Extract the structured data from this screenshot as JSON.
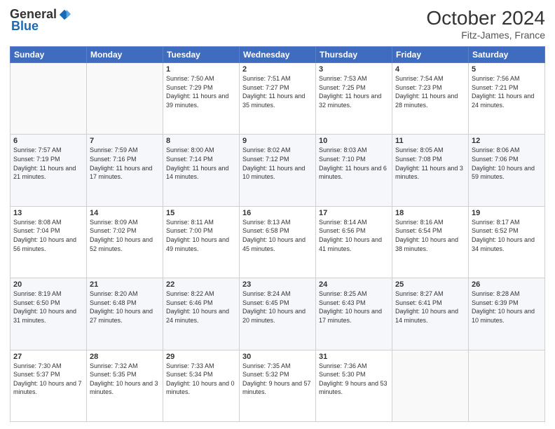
{
  "header": {
    "logo_general": "General",
    "logo_blue": "Blue",
    "month": "October 2024",
    "location": "Fitz-James, France"
  },
  "weekdays": [
    "Sunday",
    "Monday",
    "Tuesday",
    "Wednesday",
    "Thursday",
    "Friday",
    "Saturday"
  ],
  "weeks": [
    [
      {
        "day": "",
        "sunrise": "",
        "sunset": "",
        "daylight": ""
      },
      {
        "day": "",
        "sunrise": "",
        "sunset": "",
        "daylight": ""
      },
      {
        "day": "1",
        "sunrise": "Sunrise: 7:50 AM",
        "sunset": "Sunset: 7:29 PM",
        "daylight": "Daylight: 11 hours and 39 minutes."
      },
      {
        "day": "2",
        "sunrise": "Sunrise: 7:51 AM",
        "sunset": "Sunset: 7:27 PM",
        "daylight": "Daylight: 11 hours and 35 minutes."
      },
      {
        "day": "3",
        "sunrise": "Sunrise: 7:53 AM",
        "sunset": "Sunset: 7:25 PM",
        "daylight": "Daylight: 11 hours and 32 minutes."
      },
      {
        "day": "4",
        "sunrise": "Sunrise: 7:54 AM",
        "sunset": "Sunset: 7:23 PM",
        "daylight": "Daylight: 11 hours and 28 minutes."
      },
      {
        "day": "5",
        "sunrise": "Sunrise: 7:56 AM",
        "sunset": "Sunset: 7:21 PM",
        "daylight": "Daylight: 11 hours and 24 minutes."
      }
    ],
    [
      {
        "day": "6",
        "sunrise": "Sunrise: 7:57 AM",
        "sunset": "Sunset: 7:19 PM",
        "daylight": "Daylight: 11 hours and 21 minutes."
      },
      {
        "day": "7",
        "sunrise": "Sunrise: 7:59 AM",
        "sunset": "Sunset: 7:16 PM",
        "daylight": "Daylight: 11 hours and 17 minutes."
      },
      {
        "day": "8",
        "sunrise": "Sunrise: 8:00 AM",
        "sunset": "Sunset: 7:14 PM",
        "daylight": "Daylight: 11 hours and 14 minutes."
      },
      {
        "day": "9",
        "sunrise": "Sunrise: 8:02 AM",
        "sunset": "Sunset: 7:12 PM",
        "daylight": "Daylight: 11 hours and 10 minutes."
      },
      {
        "day": "10",
        "sunrise": "Sunrise: 8:03 AM",
        "sunset": "Sunset: 7:10 PM",
        "daylight": "Daylight: 11 hours and 6 minutes."
      },
      {
        "day": "11",
        "sunrise": "Sunrise: 8:05 AM",
        "sunset": "Sunset: 7:08 PM",
        "daylight": "Daylight: 11 hours and 3 minutes."
      },
      {
        "day": "12",
        "sunrise": "Sunrise: 8:06 AM",
        "sunset": "Sunset: 7:06 PM",
        "daylight": "Daylight: 10 hours and 59 minutes."
      }
    ],
    [
      {
        "day": "13",
        "sunrise": "Sunrise: 8:08 AM",
        "sunset": "Sunset: 7:04 PM",
        "daylight": "Daylight: 10 hours and 56 minutes."
      },
      {
        "day": "14",
        "sunrise": "Sunrise: 8:09 AM",
        "sunset": "Sunset: 7:02 PM",
        "daylight": "Daylight: 10 hours and 52 minutes."
      },
      {
        "day": "15",
        "sunrise": "Sunrise: 8:11 AM",
        "sunset": "Sunset: 7:00 PM",
        "daylight": "Daylight: 10 hours and 49 minutes."
      },
      {
        "day": "16",
        "sunrise": "Sunrise: 8:13 AM",
        "sunset": "Sunset: 6:58 PM",
        "daylight": "Daylight: 10 hours and 45 minutes."
      },
      {
        "day": "17",
        "sunrise": "Sunrise: 8:14 AM",
        "sunset": "Sunset: 6:56 PM",
        "daylight": "Daylight: 10 hours and 41 minutes."
      },
      {
        "day": "18",
        "sunrise": "Sunrise: 8:16 AM",
        "sunset": "Sunset: 6:54 PM",
        "daylight": "Daylight: 10 hours and 38 minutes."
      },
      {
        "day": "19",
        "sunrise": "Sunrise: 8:17 AM",
        "sunset": "Sunset: 6:52 PM",
        "daylight": "Daylight: 10 hours and 34 minutes."
      }
    ],
    [
      {
        "day": "20",
        "sunrise": "Sunrise: 8:19 AM",
        "sunset": "Sunset: 6:50 PM",
        "daylight": "Daylight: 10 hours and 31 minutes."
      },
      {
        "day": "21",
        "sunrise": "Sunrise: 8:20 AM",
        "sunset": "Sunset: 6:48 PM",
        "daylight": "Daylight: 10 hours and 27 minutes."
      },
      {
        "day": "22",
        "sunrise": "Sunrise: 8:22 AM",
        "sunset": "Sunset: 6:46 PM",
        "daylight": "Daylight: 10 hours and 24 minutes."
      },
      {
        "day": "23",
        "sunrise": "Sunrise: 8:24 AM",
        "sunset": "Sunset: 6:45 PM",
        "daylight": "Daylight: 10 hours and 20 minutes."
      },
      {
        "day": "24",
        "sunrise": "Sunrise: 8:25 AM",
        "sunset": "Sunset: 6:43 PM",
        "daylight": "Daylight: 10 hours and 17 minutes."
      },
      {
        "day": "25",
        "sunrise": "Sunrise: 8:27 AM",
        "sunset": "Sunset: 6:41 PM",
        "daylight": "Daylight: 10 hours and 14 minutes."
      },
      {
        "day": "26",
        "sunrise": "Sunrise: 8:28 AM",
        "sunset": "Sunset: 6:39 PM",
        "daylight": "Daylight: 10 hours and 10 minutes."
      }
    ],
    [
      {
        "day": "27",
        "sunrise": "Sunrise: 7:30 AM",
        "sunset": "Sunset: 5:37 PM",
        "daylight": "Daylight: 10 hours and 7 minutes."
      },
      {
        "day": "28",
        "sunrise": "Sunrise: 7:32 AM",
        "sunset": "Sunset: 5:35 PM",
        "daylight": "Daylight: 10 hours and 3 minutes."
      },
      {
        "day": "29",
        "sunrise": "Sunrise: 7:33 AM",
        "sunset": "Sunset: 5:34 PM",
        "daylight": "Daylight: 10 hours and 0 minutes."
      },
      {
        "day": "30",
        "sunrise": "Sunrise: 7:35 AM",
        "sunset": "Sunset: 5:32 PM",
        "daylight": "Daylight: 9 hours and 57 minutes."
      },
      {
        "day": "31",
        "sunrise": "Sunrise: 7:36 AM",
        "sunset": "Sunset: 5:30 PM",
        "daylight": "Daylight: 9 hours and 53 minutes."
      },
      {
        "day": "",
        "sunrise": "",
        "sunset": "",
        "daylight": ""
      },
      {
        "day": "",
        "sunrise": "",
        "sunset": "",
        "daylight": ""
      }
    ]
  ]
}
